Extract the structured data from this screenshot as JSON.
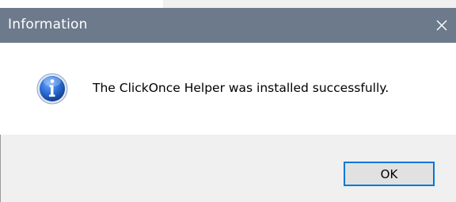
{
  "dialog": {
    "title": "Information",
    "message": "The ClickOnce Helper was installed successfully.",
    "ok_label": "OK",
    "icon": "information-icon",
    "close_icon": "close-icon"
  },
  "colors": {
    "titlebar": "#6c7a8c",
    "title_text": "#ffffff",
    "footer": "#f0f0f0",
    "ok_border": "#0078d7",
    "ok_fill": "#e1e1e1",
    "info_blue": "#1e5fbf"
  }
}
